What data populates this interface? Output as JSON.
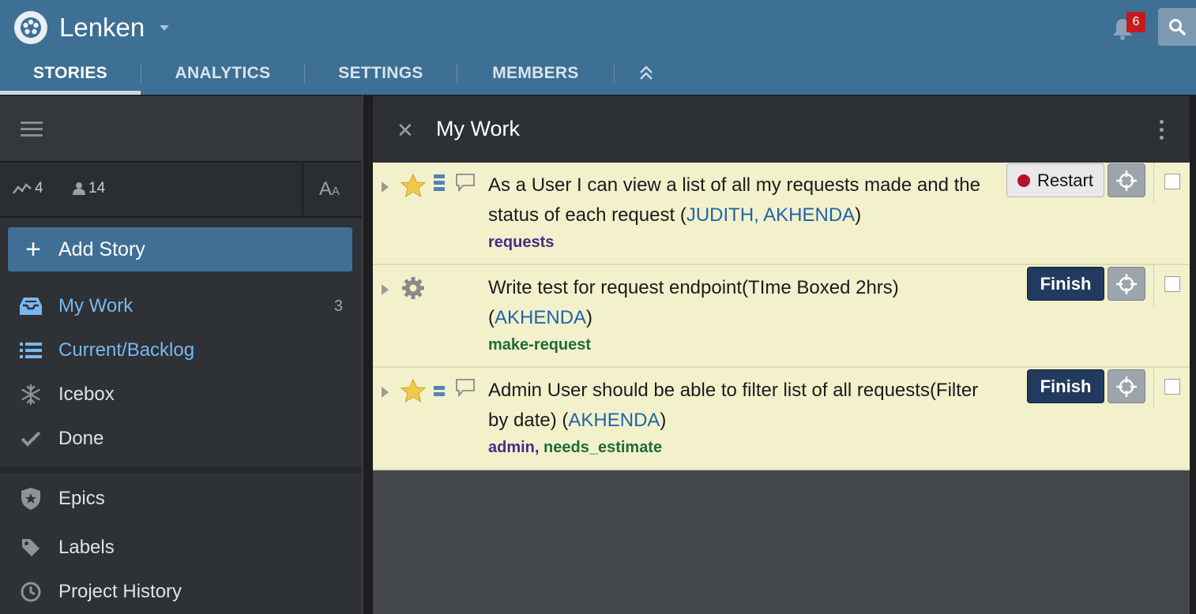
{
  "header": {
    "project_name": "Lenken",
    "notification_count": "6",
    "tabs": [
      {
        "label": "STORIES",
        "active": true
      },
      {
        "label": "ANALYTICS",
        "active": false
      },
      {
        "label": "SETTINGS",
        "active": false
      },
      {
        "label": "MEMBERS",
        "active": false
      }
    ]
  },
  "sidebar": {
    "stats": {
      "velocity": "4",
      "members": "14"
    },
    "font_toggle": {
      "big": "A",
      "small": "A"
    },
    "add_story_label": "Add Story",
    "nav": [
      {
        "label": "My Work",
        "count": "3",
        "icon": "inbox-icon"
      },
      {
        "label": "Current/Backlog",
        "icon": "list-icon"
      },
      {
        "label": "Icebox",
        "icon": "snowflake-icon"
      },
      {
        "label": "Done",
        "icon": "check-icon"
      },
      {
        "label": "Epics",
        "icon": "shield-star-icon"
      },
      {
        "label": "Labels",
        "icon": "tag-icon"
      },
      {
        "label": "Project History",
        "icon": "clock-icon"
      }
    ]
  },
  "panel": {
    "title": "My Work",
    "close_glyph": "✕"
  },
  "stories": [
    {
      "type": "feature",
      "title": "As a User I can view a list of all my requests made and the status of each request",
      "owners": "JUDITH, AKHENDA",
      "labels": [
        {
          "text": "requests",
          "color": "purple"
        }
      ],
      "action": "Restart"
    },
    {
      "type": "chore",
      "title": "Write test for request endpoint(TIme Boxed 2hrs)",
      "owners": "AKHENDA",
      "labels": [
        {
          "text": "make-request",
          "color": "green"
        }
      ],
      "action": "Finish"
    },
    {
      "type": "feature",
      "title": "Admin User should be able to filter list of all requests(Filter by date)",
      "owners": "AKHENDA",
      "labels": [
        {
          "text": "admin,",
          "color": "purple"
        },
        {
          "text": "needs_estimate",
          "color": "green"
        }
      ],
      "action": "Finish"
    }
  ],
  "colors": {
    "header_bg": "#3e6f94",
    "story_bg": "#f3f1cc",
    "link_blue": "#78b8ef",
    "finish_btn": "#223a5e",
    "restart_dot": "#b5122d"
  }
}
